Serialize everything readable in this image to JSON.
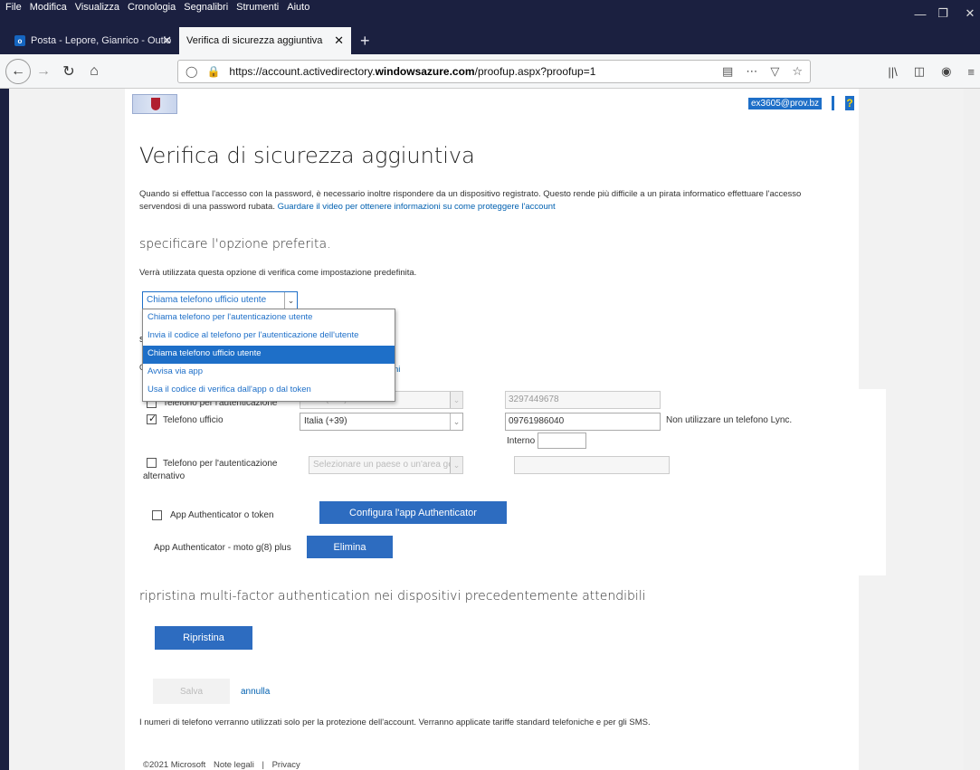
{
  "menubar": {
    "items": [
      "File",
      "Modifica",
      "Visualizza",
      "Cronologia",
      "Segnalibri",
      "Strumenti",
      "Aiuto"
    ]
  },
  "window": {
    "minimize": "—",
    "restore": "❐",
    "close": "✕"
  },
  "tabs": [
    {
      "label": "Posta - Lepore, Gianrico - Outlo",
      "close": "✕",
      "favicon": "outlook-icon"
    },
    {
      "label": "Verifica di sicurezza aggiuntiva",
      "close": "✕"
    }
  ],
  "newtab_label": "+",
  "nav": {
    "url_prefix": "https://account.activedirectory.",
    "url_domain": "windowsazure.com",
    "url_suffix": "/proofup.aspx?proofup=1"
  },
  "header": {
    "user": "ex3605@prov.bz",
    "help": "?"
  },
  "page": {
    "title": "Verifica di sicurezza aggiuntiva",
    "intro": "Quando si effettua l'accesso con la password, è necessario inoltre rispondere da un dispositivo registrato. Questo rende più difficile a un pirata informatico effettuare l'accesso servendosi di una password rubata.",
    "intro_link": "Guardare il video per ottenere informazioni su come proteggere l'account",
    "section_preferred": "specificare l'opzione preferita.",
    "default_note": "Verrà utilizzata questa opzione di verifica come impostazione predefinita.",
    "selected_option": "Chiama telefono ufficio utente",
    "options": [
      "Chiama telefono per l'autenticazione utente",
      "Invia il codice al telefono per l'autenticazione dell'utente",
      "Chiama telefono ufficio utente",
      "Avvisa via app",
      "Usa il codice di verifica dall'app o dal token"
    ],
    "behind_dropdown_1": "s",
    "behind_dropdown_2": "C",
    "behind_dropdown_link": "ni"
  },
  "methods": {
    "auth_phone": {
      "label": "Telefono per l'autenticazione",
      "country": "Italia (+39)",
      "number": "3297449678"
    },
    "office_phone": {
      "label": "Telefono ufficio",
      "country": "Italia (+39)",
      "number": "09761986040",
      "note": "Non utilizzare un telefono Lync.",
      "ext_label": "Interno",
      "ext_value": ""
    },
    "alt_phone": {
      "label": "Telefono per l'autenticazione alternativo",
      "country_placeholder": "Selezionare un paese o un'area geografica",
      "number": ""
    },
    "authenticator": {
      "label": "App Authenticator o token",
      "configure": "Configura l'app Authenticator"
    },
    "device": {
      "label": "App Authenticator - moto g(8) plus",
      "delete": "Elimina"
    }
  },
  "reset": {
    "title": "ripristina multi-factor authentication nei dispositivi precedentemente attendibili",
    "button": "Ripristina"
  },
  "actions": {
    "save": "Salva",
    "cancel": "annulla"
  },
  "phone_note": "I numeri di telefono verranno utilizzati solo per la protezione dell'account. Verranno applicate tariffe standard telefoniche e per gli SMS.",
  "footer": {
    "copyright": "©2021 Microsoft",
    "legal": "Note legali",
    "sep": "|",
    "privacy": "Privacy"
  }
}
